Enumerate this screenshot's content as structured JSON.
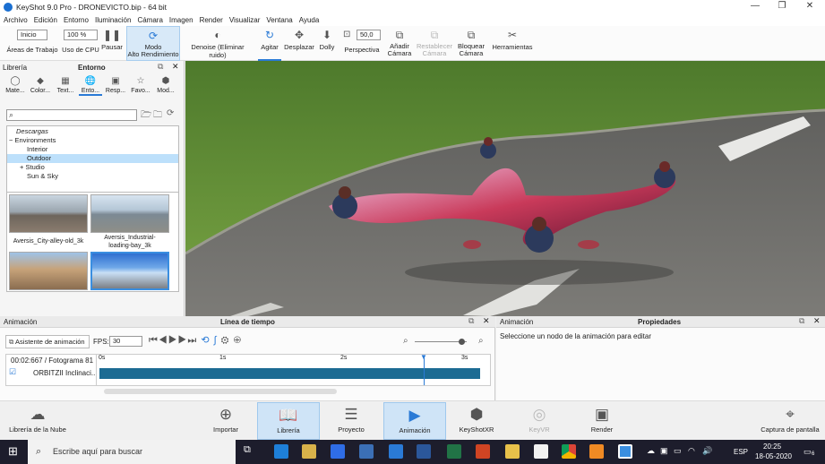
{
  "window": {
    "title": "KeyShot 9.0 Pro  -  DRONEVICTO.bip  -  64 bit",
    "minimize": "—",
    "restore": "❐",
    "close": "✕"
  },
  "menu": [
    "Archivo",
    "Edición",
    "Entorno",
    "Iluminación",
    "Cámara",
    "Imagen",
    "Render",
    "Visualizar",
    "Ventana",
    "Ayuda"
  ],
  "toolbar": {
    "workspace_value": "Inicio",
    "workspace_label": "Áreas de Trabajo",
    "cpu_value": "100 %",
    "cpu_label": "Uso de CPU",
    "pause": "Pausar",
    "perf_mode": "Modo\nAlto Rendimiento",
    "denoise": "Denoise (Eliminar ruido)",
    "tumble": "Agitar",
    "pan": "Desplazar",
    "dolly": "Dolly",
    "perspective_value": "50,0",
    "perspective": "Perspectiva",
    "add_camera": "Añadir\nCámara",
    "reset_camera": "Restablecer\nCámara",
    "lock_camera": "Bloquear\nCámara",
    "tools": "Herramientas"
  },
  "library": {
    "title": "Librería",
    "tab": "Entorno",
    "categories": [
      "Mate...",
      "Color...",
      "Text...",
      "Ento...",
      "Resp...",
      "Favo...",
      "Mod..."
    ],
    "search_placeholder": "",
    "tree": [
      {
        "label": "Descargas",
        "indent": 1,
        "italic": true
      },
      {
        "label": "Environments",
        "indent": 0,
        "prefix": "−"
      },
      {
        "label": "Interior",
        "indent": 2
      },
      {
        "label": "Outdoor",
        "indent": 2,
        "selected": true
      },
      {
        "label": "Studio",
        "indent": 2,
        "prefix": "+"
      },
      {
        "label": "Sun & Sky",
        "indent": 2
      }
    ],
    "thumbs": [
      "Aversis_City-alley-old_3k",
      "Aversis_Industrial-\nloading-bay_3k"
    ]
  },
  "animation": {
    "title": "Animación",
    "timeline_title": "Línea de tiempo",
    "wizard": "Asistente de animación",
    "fps_label": "FPS:",
    "fps_value": "30",
    "time_frame": "00:02:667 / Fotograma 81",
    "track": "ORBITZII Inclinaci...",
    "ticks": [
      "0s",
      "1s",
      "2s",
      "3s"
    ]
  },
  "properties": {
    "title": "Animación",
    "heading": "Propiedades",
    "message": "Seleccione un nodo de la animación para editar"
  },
  "bottom": {
    "cloud": "Librería de la Nube",
    "import": "Importar",
    "library": "Librería",
    "project": "Proyecto",
    "animation": "Animación",
    "keyshotxr": "KeyShotXR",
    "keyvr": "KeyVR",
    "render": "Render",
    "screenshot": "Captura de pantalla"
  },
  "taskbar": {
    "search": "Escribe aquí para buscar",
    "lang": "ESP",
    "time": "20:25",
    "date": "18-05-2020",
    "notif": "6"
  }
}
